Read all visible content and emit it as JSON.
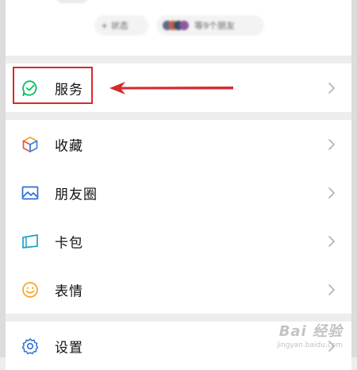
{
  "profile": {
    "status_button": "+ 状态",
    "friends_status_text": "等9个朋友"
  },
  "menu": {
    "services": "服务",
    "favorites": "收藏",
    "moments": "朋友圈",
    "cards": "卡包",
    "stickers": "表情",
    "settings": "设置"
  },
  "watermark": {
    "logo": "Bai 经验",
    "sub": "jingyan.baidu.com"
  },
  "colors": {
    "background": "#ededed",
    "services_icon": "#07c160",
    "annotation_red": "#d52b2b",
    "moments_icon": "#2b6fd6",
    "stickers_icon": "#f5a623",
    "settings_icon": "#2b6fd6"
  }
}
